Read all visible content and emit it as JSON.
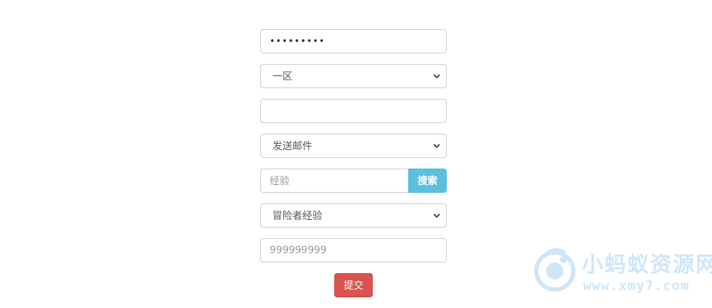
{
  "form": {
    "password_value": "•••••••••",
    "region_select": {
      "selected": "一区"
    },
    "blank_input": {
      "value": ""
    },
    "action_select": {
      "selected": "发送邮件"
    },
    "search": {
      "placeholder": "经验",
      "button_label": "搜索"
    },
    "type_select": {
      "selected": "冒险者经验"
    },
    "amount_input": {
      "value": "999999999"
    },
    "submit_label": "提交"
  },
  "watermark": {
    "title": "小蚂蚁资源网",
    "url": "www.xmy7.com"
  },
  "colors": {
    "search_button": "#5bc0de",
    "submit_button": "#d9534f",
    "watermark": "#a9d3f2"
  }
}
